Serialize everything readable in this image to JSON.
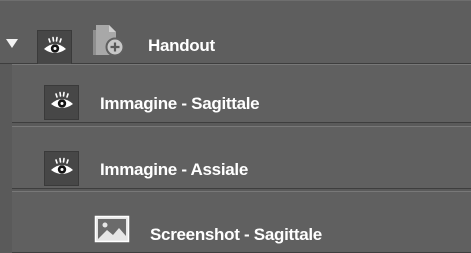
{
  "tree": {
    "root": {
      "label": "Handout",
      "icon": "handout-add-icon",
      "visibility_icon": "eye-icon",
      "expanded": true
    },
    "children": [
      {
        "label": "Immagine - Sagittale",
        "visibility_icon": "eye-icon"
      },
      {
        "label": "Immagine - Assiale",
        "visibility_icon": "eye-icon"
      },
      {
        "label": "Screenshot - Sagittale",
        "icon": "image-icon"
      }
    ]
  },
  "colors": {
    "row_bg": "#606060",
    "button_bg": "#474747",
    "text": "#ffffff"
  }
}
